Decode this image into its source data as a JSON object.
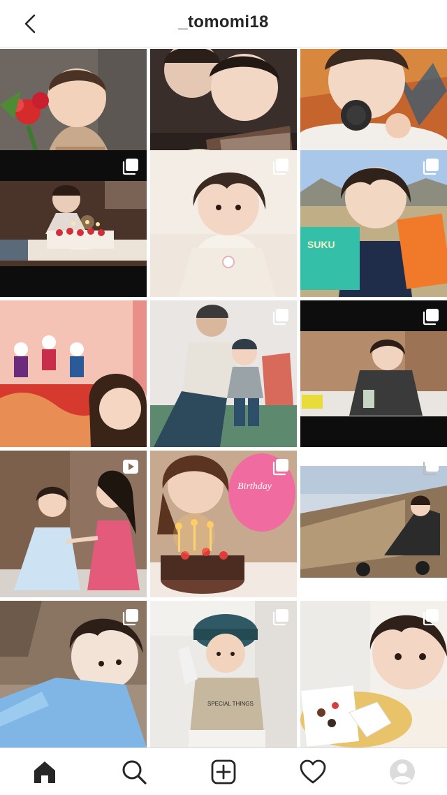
{
  "header": {
    "username": "_tomomi18",
    "back_icon": "chevron-left-icon"
  },
  "grid": {
    "columns": 3,
    "posts": [
      {
        "type": "photo",
        "subject": "child holding red carnations",
        "colors": [
          "#8a6b55",
          "#c9b39b",
          "#d62b2b"
        ]
      },
      {
        "type": "photo",
        "subject": "two children eating dessert",
        "colors": [
          "#3a2e2a",
          "#e6d8c8",
          "#7b5a48"
        ]
      },
      {
        "type": "photo",
        "subject": "child with smart watch",
        "colors": [
          "#c6642e",
          "#f2efea",
          "#2c2c2c"
        ]
      },
      {
        "type": "carousel",
        "subject": "birthday cake with candles",
        "colors": [
          "#0d0d0d",
          "#6b4a3a",
          "#ffe3b0"
        ]
      },
      {
        "type": "carousel",
        "subject": "child in cream cardigan",
        "colors": [
          "#f1e9df",
          "#f6f2ea",
          "#3b2c25"
        ]
      },
      {
        "type": "carousel",
        "subject": "child holding snack bags outdoors",
        "colors": [
          "#a9c7e9",
          "#bfae86",
          "#f07a2a"
        ]
      },
      {
        "type": "photo",
        "subject": "hina doll display",
        "colors": [
          "#e98f8a",
          "#f7c9b8",
          "#d53a2f"
        ]
      },
      {
        "type": "carousel",
        "subject": "father and child on chair",
        "colors": [
          "#e9e6e3",
          "#5d8a6f",
          "#2d4a5c"
        ]
      },
      {
        "type": "carousel",
        "subject": "child at table",
        "colors": [
          "#0d0d0d",
          "#b58c6b",
          "#3a3a3a"
        ]
      },
      {
        "type": "video",
        "subject": "two girls dancing",
        "colors": [
          "#8a6d57",
          "#cde2f3",
          "#e45a7a"
        ]
      },
      {
        "type": "carousel",
        "subject": "birthday cake and balloon",
        "colors": [
          "#c7a98f",
          "#f06ca0",
          "#ffcc66"
        ]
      },
      {
        "type": "carousel",
        "subject": "child in stroller on deck",
        "colors": [
          "#cfd9e4",
          "#b59a77",
          "#2b2b2b"
        ]
      },
      {
        "type": "carousel",
        "subject": "child in blue shirt",
        "colors": [
          "#8a7462",
          "#7fb6e6",
          "#f3e3d6"
        ]
      },
      {
        "type": "carousel",
        "subject": "child in hat",
        "colors": [
          "#eceae6",
          "#c6b79f",
          "#2f5a65"
        ]
      },
      {
        "type": "carousel",
        "subject": "child with cookies",
        "colors": [
          "#f4f1ed",
          "#e8c36a",
          "#3a2a22"
        ]
      }
    ]
  },
  "bottom_nav": {
    "items": [
      {
        "name": "home-icon",
        "active": true
      },
      {
        "name": "search-icon",
        "active": false
      },
      {
        "name": "new-post-icon",
        "active": false
      },
      {
        "name": "activity-heart-icon",
        "active": false
      },
      {
        "name": "profile-avatar-icon",
        "active": false
      }
    ]
  },
  "colors": {
    "text": "#262626",
    "border": "#dbdbdb",
    "background": "#ffffff"
  }
}
